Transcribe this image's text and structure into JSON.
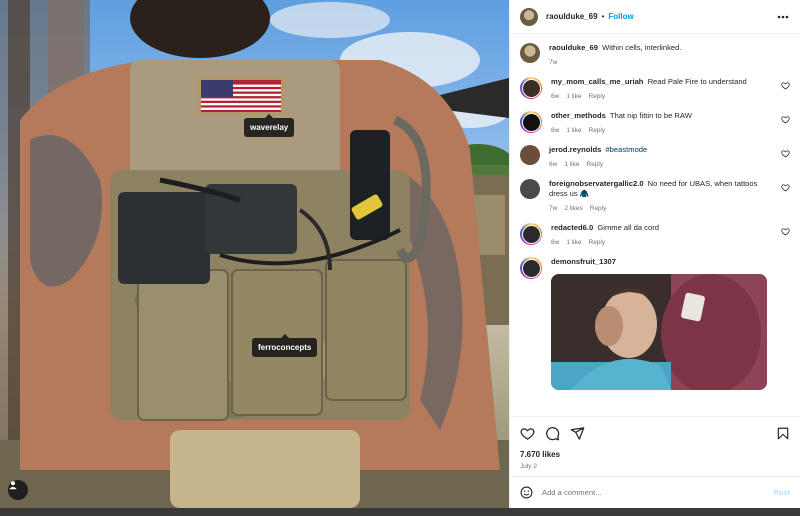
{
  "photo": {
    "tags": [
      "waverelay",
      "ferroconcepts"
    ],
    "user_tag_icon": "person-icon"
  },
  "post": {
    "author": "raoulduke_69",
    "separator": "•",
    "follow_label": "Follow",
    "caption_author": "raoulduke_69",
    "caption_text": "Within cells, interlinked.",
    "caption_age": "7w",
    "likes": "7.670 likes",
    "date": "July 2"
  },
  "comments": [
    {
      "user": "my_mom_calls_me_uriah",
      "text": "Read Pale Fire to understand",
      "age": "6w",
      "likes": "1 like",
      "reply": "Reply",
      "ring": true,
      "avatar_color": "#3a2f24"
    },
    {
      "user": "other_methods",
      "text": "That nip fittin to be RAW",
      "age": "6w",
      "likes": "1 like",
      "reply": "Reply",
      "ring": true,
      "avatar_color": "#111111"
    },
    {
      "user": "jerod.reynolds",
      "text": "",
      "hashtag": "#beastmode",
      "age": "6w",
      "likes": "1 like",
      "reply": "Reply",
      "ring": false,
      "avatar_color": "#6b4d3a"
    },
    {
      "user": "foreignobservatergallic2.0",
      "text": "No need for UBAS, when tattoos dress us 🧥",
      "age": "7w",
      "likes": "2 likes",
      "reply": "Reply",
      "ring": false,
      "avatar_color": "#4a4a4a"
    },
    {
      "user": "redacted6.0",
      "text": "Gimme all da cord",
      "age": "6w",
      "likes": "1 like",
      "reply": "Reply",
      "ring": true,
      "avatar_color": "#2b2b2b"
    },
    {
      "user": "demonsfruit_1307",
      "text": "",
      "age": "",
      "likes": "",
      "reply": "",
      "ring": true,
      "avatar_color": "#2a2a2a"
    }
  ],
  "add_comment": {
    "placeholder": "Add a comment...",
    "post_label": "Post"
  },
  "colors": {
    "follow": "#0095f6",
    "meta": "#737373",
    "hashtag": "#00376b",
    "post_disabled": "#b2dffc"
  },
  "icons": [
    "heart-icon",
    "comment-icon",
    "share-icon",
    "bookmark-icon",
    "emoji-icon",
    "more-icon"
  ]
}
